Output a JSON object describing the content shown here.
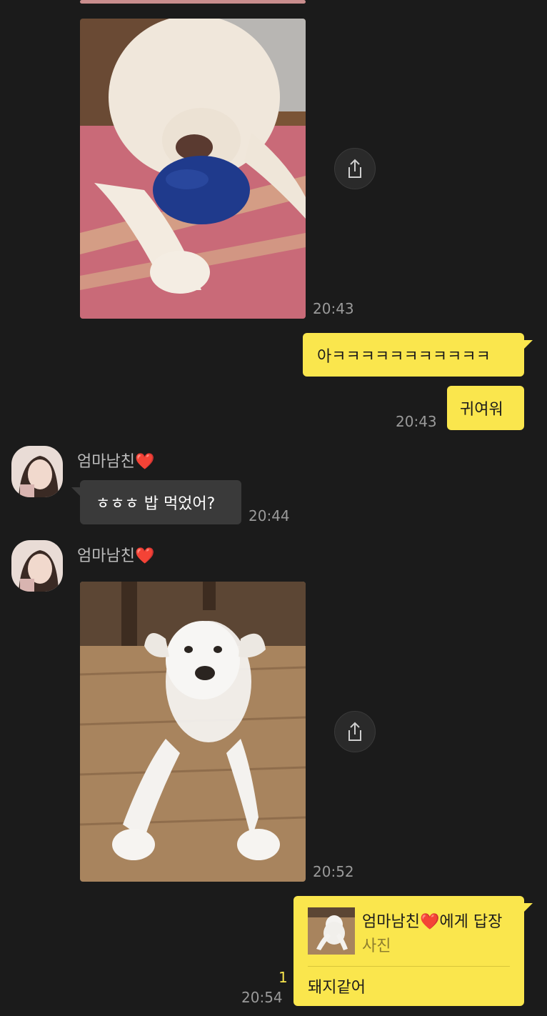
{
  "messages": {
    "photo1": {
      "time": "20:43",
      "share_icon": "share-icon"
    },
    "mine1": {
      "text": "아ㅋㅋㅋㅋㅋㅋㅋㅋㅋㅋㅋ"
    },
    "mine2": {
      "text": "귀여워",
      "time": "20:43"
    },
    "sender1": {
      "name": "엄마남친",
      "heart": "❤️",
      "text": "ㅎㅎㅎ 밥 먹었어?",
      "time": "20:44"
    },
    "sender2": {
      "name": "엄마남친",
      "heart": "❤️",
      "time": "20:52"
    },
    "reply": {
      "to_name": "엄마남친",
      "heart": "❤️",
      "suffix": "에게 답장",
      "preview_label": "사진",
      "text": "돼지같어",
      "unread": "1",
      "time": "20:54"
    }
  },
  "colors": {
    "background": "#1b1b1b",
    "my_bubble": "#fae64d",
    "their_bubble": "#3a3a3a",
    "timestamp": "#9a9a9a",
    "unread": "#fae64d"
  }
}
